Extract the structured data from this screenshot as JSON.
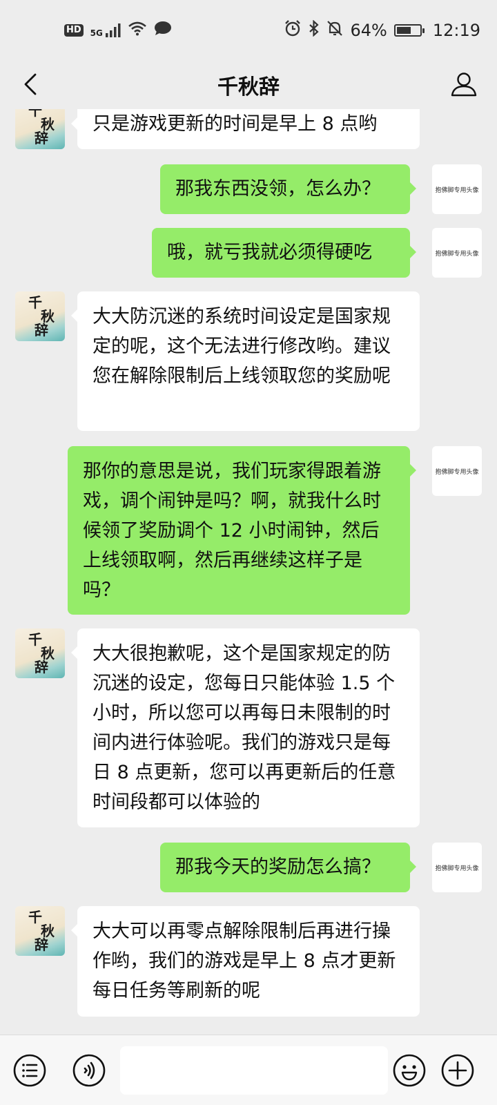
{
  "status_bar": {
    "hd": "HD",
    "network": "5G",
    "battery_text": "64%",
    "battery_level": 0.64,
    "time": "12:19"
  },
  "header": {
    "title": "千秋辞"
  },
  "contact_logo_text": "千秋辞",
  "my_avatar_text": "抱佛脚专用头像",
  "messages": [
    {
      "side": "left",
      "text": "只是游戏更新的时间是早上 8 点哟"
    },
    {
      "side": "right",
      "text": "那我东西没领，怎么办？"
    },
    {
      "side": "right",
      "text": "哦，就亏我就必须得硬吃"
    },
    {
      "side": "left",
      "text": "大大防沉迷的系统时间设定是国家规定的呢，这个无法进行修改哟。建议您在解除限制后上线领取您的奖励呢"
    },
    {
      "side": "right",
      "text": "那你的意思是说，我们玩家得跟着游戏，调个闹钟是吗？啊，就我什么时候领了奖励调个 12 小时闹钟，然后上线领取啊，然后再继续这样子是吗？"
    },
    {
      "side": "left",
      "text": "大大很抱歉呢，这个是国家规定的防沉迷的设定，您每日只能体验 1.5 个小时，所以您可以再每日未限制的时间内进行体验呢。我们的游戏只是每日 8 点更新，您可以再更新后的任意时间段都可以体验的"
    },
    {
      "side": "right",
      "text": "那我今天的奖励怎么搞？"
    },
    {
      "side": "left",
      "text": "大大可以再零点解除限制后再进行操作哟，我们的游戏是早上 8 点才更新每日任务等刷新的呢"
    }
  ],
  "input": {
    "value": "",
    "placeholder": ""
  }
}
